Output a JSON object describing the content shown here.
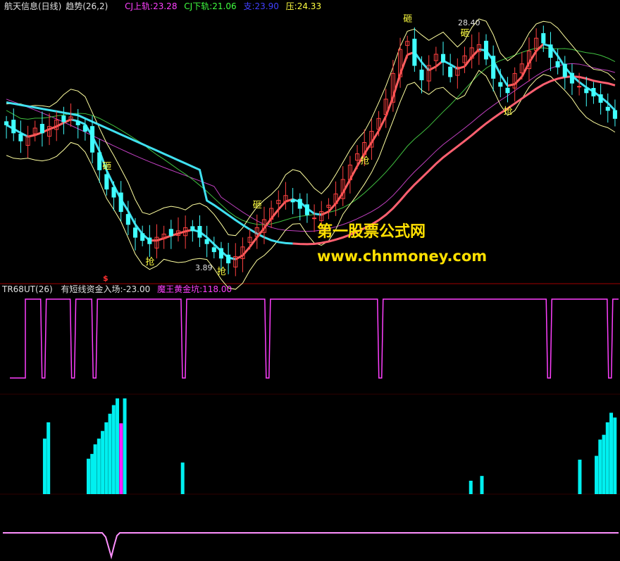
{
  "header": {
    "stock_name": "航天信息(日线)",
    "indicator_name": "趋势(26,2)",
    "upper_label": "CJ上轨:",
    "upper_value": "23.28",
    "lower_label": "CJ下轨:",
    "lower_value": "21.06",
    "support_label": "支:",
    "support_value": "23.90",
    "resistance_label": "压:",
    "resistance_value": "24.33"
  },
  "sub_header": {
    "indicator": "TR68UT(26)",
    "short_line_label": "有短线资金入场:",
    "short_line_value": "-23.00",
    "golden_pit_label": "魔王黄金坑:",
    "golden_pit_value": "118.00"
  },
  "annotations": {
    "high_price": "28.40",
    "low_price": "3.89",
    "smash_char": "砸",
    "grab_char": "抢",
    "dollar_mark": "$"
  },
  "watermark": {
    "line1": "第一股票公式网",
    "line2": "www.chnmoney.com"
  },
  "colors": {
    "background": "#000000",
    "up_candle": "#ff4040",
    "down_candle": "#40ffff",
    "trend_up": "#ff6060",
    "trend_down": "#40e0f0",
    "long_ma": "#ff6070",
    "band": "#ffffa0",
    "mid_line": "#40c040",
    "slow_line": "#c040c0",
    "signal_line": "#ff40ff",
    "histogram_cyan": "#00f0f0",
    "histogram_magenta": "#ff20ff",
    "bottom_line": "#ff90ff",
    "label_yellow": "#ffff40",
    "separator": "#a00000"
  },
  "chart_data": [
    {
      "type": "line",
      "title": "趋势(26,2)",
      "description_series": [
        {
          "name": "CJ上轨",
          "last_value": 23.28
        },
        {
          "name": "CJ下轨",
          "last_value": 21.06
        },
        {
          "name": "支",
          "last_value": 23.9
        },
        {
          "name": "压",
          "last_value": 24.33
        }
      ],
      "price_series": [
        22.6,
        22.1,
        21.6,
        21.9,
        22.4,
        22.1,
        22.5,
        22.9,
        22.8,
        23.1,
        22.6,
        22.2,
        20.9,
        19.8,
        18.6,
        18.1,
        17.2,
        16.4,
        15.6,
        15.4,
        15.2,
        15.6,
        15.8,
        15.7,
        16.0,
        16.2,
        16.0,
        15.6,
        15.2,
        14.7,
        14.3,
        14.0,
        14.4,
        15.0,
        15.6,
        16.2,
        16.7,
        17.4,
        17.9,
        18.2,
        17.8,
        17.4,
        17.0,
        16.8,
        17.2,
        17.6,
        18.3,
        19.2,
        20.1,
        20.8,
        21.5,
        22.2,
        23.0,
        24.2,
        25.8,
        27.3,
        27.8,
        26.3,
        25.4,
        26.3,
        27.0,
        26.5,
        25.6,
        26.2,
        26.9,
        27.4,
        27.6,
        26.7,
        25.5,
        25.0,
        24.6,
        25.8,
        26.4,
        27.2,
        28.0,
        27.7,
        26.8,
        26.2,
        25.6,
        25.2,
        25.0,
        24.6,
        24.4,
        24.0,
        23.5,
        23.0
      ],
      "key_levels": {
        "high": 28.4,
        "low": 3.89
      },
      "signals": [
        {
          "label": "砸",
          "index": 14
        },
        {
          "label": "砸",
          "index": 35
        },
        {
          "label": "砸",
          "index": 56
        },
        {
          "label": "砸",
          "index": 64
        },
        {
          "label": "抢",
          "index": 20
        },
        {
          "label": "抢",
          "index": 30
        },
        {
          "label": "抢",
          "index": 50
        },
        {
          "label": "抢",
          "index": 70
        }
      ]
    },
    {
      "type": "line",
      "title": "TR68UT(26)",
      "series": [
        {
          "name": "有短线资金入场",
          "last_value": -23.0
        },
        {
          "name": "魔王黄金坑",
          "last_value": 118.0
        }
      ],
      "pulse_dips_x_fraction": [
        0.066,
        0.114,
        0.149,
        0.294,
        0.43,
        0.613,
        0.887,
        0.986
      ]
    },
    {
      "type": "bar",
      "title": "histogram",
      "bars": [
        {
          "x": 0.068,
          "v": 0.58,
          "c": "cyan"
        },
        {
          "x": 0.074,
          "v": 0.75,
          "c": "cyan"
        },
        {
          "x": 0.139,
          "v": 0.37,
          "c": "cyan"
        },
        {
          "x": 0.145,
          "v": 0.42,
          "c": "cyan"
        },
        {
          "x": 0.15,
          "v": 0.52,
          "c": "cyan"
        },
        {
          "x": 0.156,
          "v": 0.58,
          "c": "cyan"
        },
        {
          "x": 0.162,
          "v": 0.66,
          "c": "cyan"
        },
        {
          "x": 0.168,
          "v": 0.75,
          "c": "cyan"
        },
        {
          "x": 0.174,
          "v": 0.84,
          "c": "cyan"
        },
        {
          "x": 0.18,
          "v": 0.93,
          "c": "cyan"
        },
        {
          "x": 0.186,
          "v": 1.0,
          "c": "cyan"
        },
        {
          "x": 0.192,
          "v": 0.74,
          "c": "magenta"
        },
        {
          "x": 0.198,
          "v": 1.0,
          "c": "cyan"
        },
        {
          "x": 0.292,
          "v": 0.33,
          "c": "cyan"
        },
        {
          "x": 0.76,
          "v": 0.14,
          "c": "cyan"
        },
        {
          "x": 0.778,
          "v": 0.19,
          "c": "cyan"
        },
        {
          "x": 0.937,
          "v": 0.36,
          "c": "cyan"
        },
        {
          "x": 0.964,
          "v": 0.4,
          "c": "cyan"
        },
        {
          "x": 0.97,
          "v": 0.57,
          "c": "cyan"
        },
        {
          "x": 0.976,
          "v": 0.62,
          "c": "cyan"
        },
        {
          "x": 0.982,
          "v": 0.75,
          "c": "cyan"
        },
        {
          "x": 0.988,
          "v": 0.85,
          "c": "cyan"
        },
        {
          "x": 0.994,
          "v": 0.8,
          "c": "cyan"
        }
      ]
    }
  ]
}
